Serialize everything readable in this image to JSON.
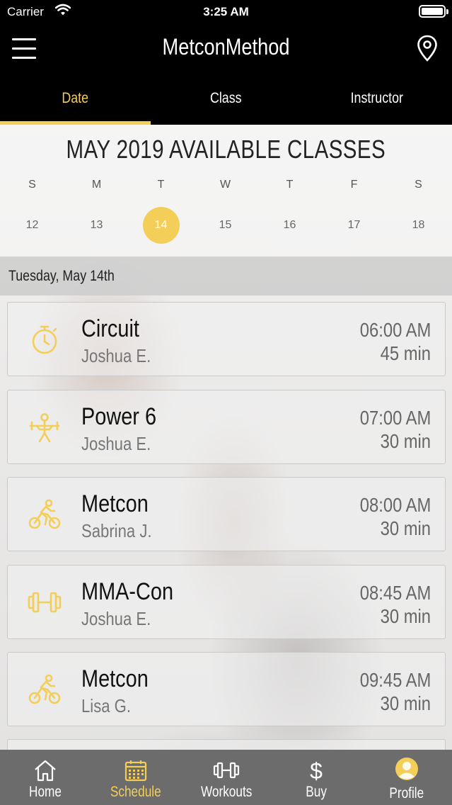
{
  "status_bar": {
    "carrier": "Carrier",
    "time": "3:25 AM"
  },
  "nav": {
    "title": "MetconMethod"
  },
  "tabs": [
    {
      "label": "Date",
      "active": true
    },
    {
      "label": "Class",
      "active": false
    },
    {
      "label": "Instructor",
      "active": false
    }
  ],
  "calendar": {
    "heading": "MAY 2019 AVAILABLE CLASSES",
    "days_of_week": [
      "S",
      "M",
      "T",
      "W",
      "T",
      "F",
      "S"
    ],
    "dates": [
      "12",
      "13",
      "14",
      "15",
      "16",
      "17",
      "18"
    ],
    "selected_date": "14"
  },
  "selected_day_label": "Tuesday, May 14th",
  "classes": [
    {
      "name": "Circuit",
      "instructor": "Joshua E.",
      "time": "06:00 AM",
      "duration": "45 min",
      "icon": "stopwatch-icon"
    },
    {
      "name": "Power 6",
      "instructor": "Joshua E.",
      "time": "07:00 AM",
      "duration": "30 min",
      "icon": "weightlifter-icon"
    },
    {
      "name": "Metcon",
      "instructor": "Sabrina J.",
      "time": "08:00 AM",
      "duration": "30 min",
      "icon": "cyclist-icon"
    },
    {
      "name": "MMA-Con",
      "instructor": "Joshua E.",
      "time": "08:45 AM",
      "duration": "30 min",
      "icon": "dumbbell-icon"
    },
    {
      "name": "Metcon",
      "instructor": "Lisa G.",
      "time": "09:45 AM",
      "duration": "30 min",
      "icon": "cyclist-icon"
    }
  ],
  "tab_bar": [
    {
      "label": "Home",
      "icon": "home-icon",
      "active": false
    },
    {
      "label": "Schedule",
      "icon": "calendar-icon",
      "active": true
    },
    {
      "label": "Workouts",
      "icon": "dumbbell-icon",
      "active": false
    },
    {
      "label": "Buy",
      "icon": "dollar-icon",
      "active": false
    },
    {
      "label": "Profile",
      "icon": "avatar-icon",
      "active": false
    }
  ],
  "colors": {
    "accent": "#f3ce58",
    "nav_bg": "#000000",
    "tab_bar_bg": "#6c6c6c"
  }
}
